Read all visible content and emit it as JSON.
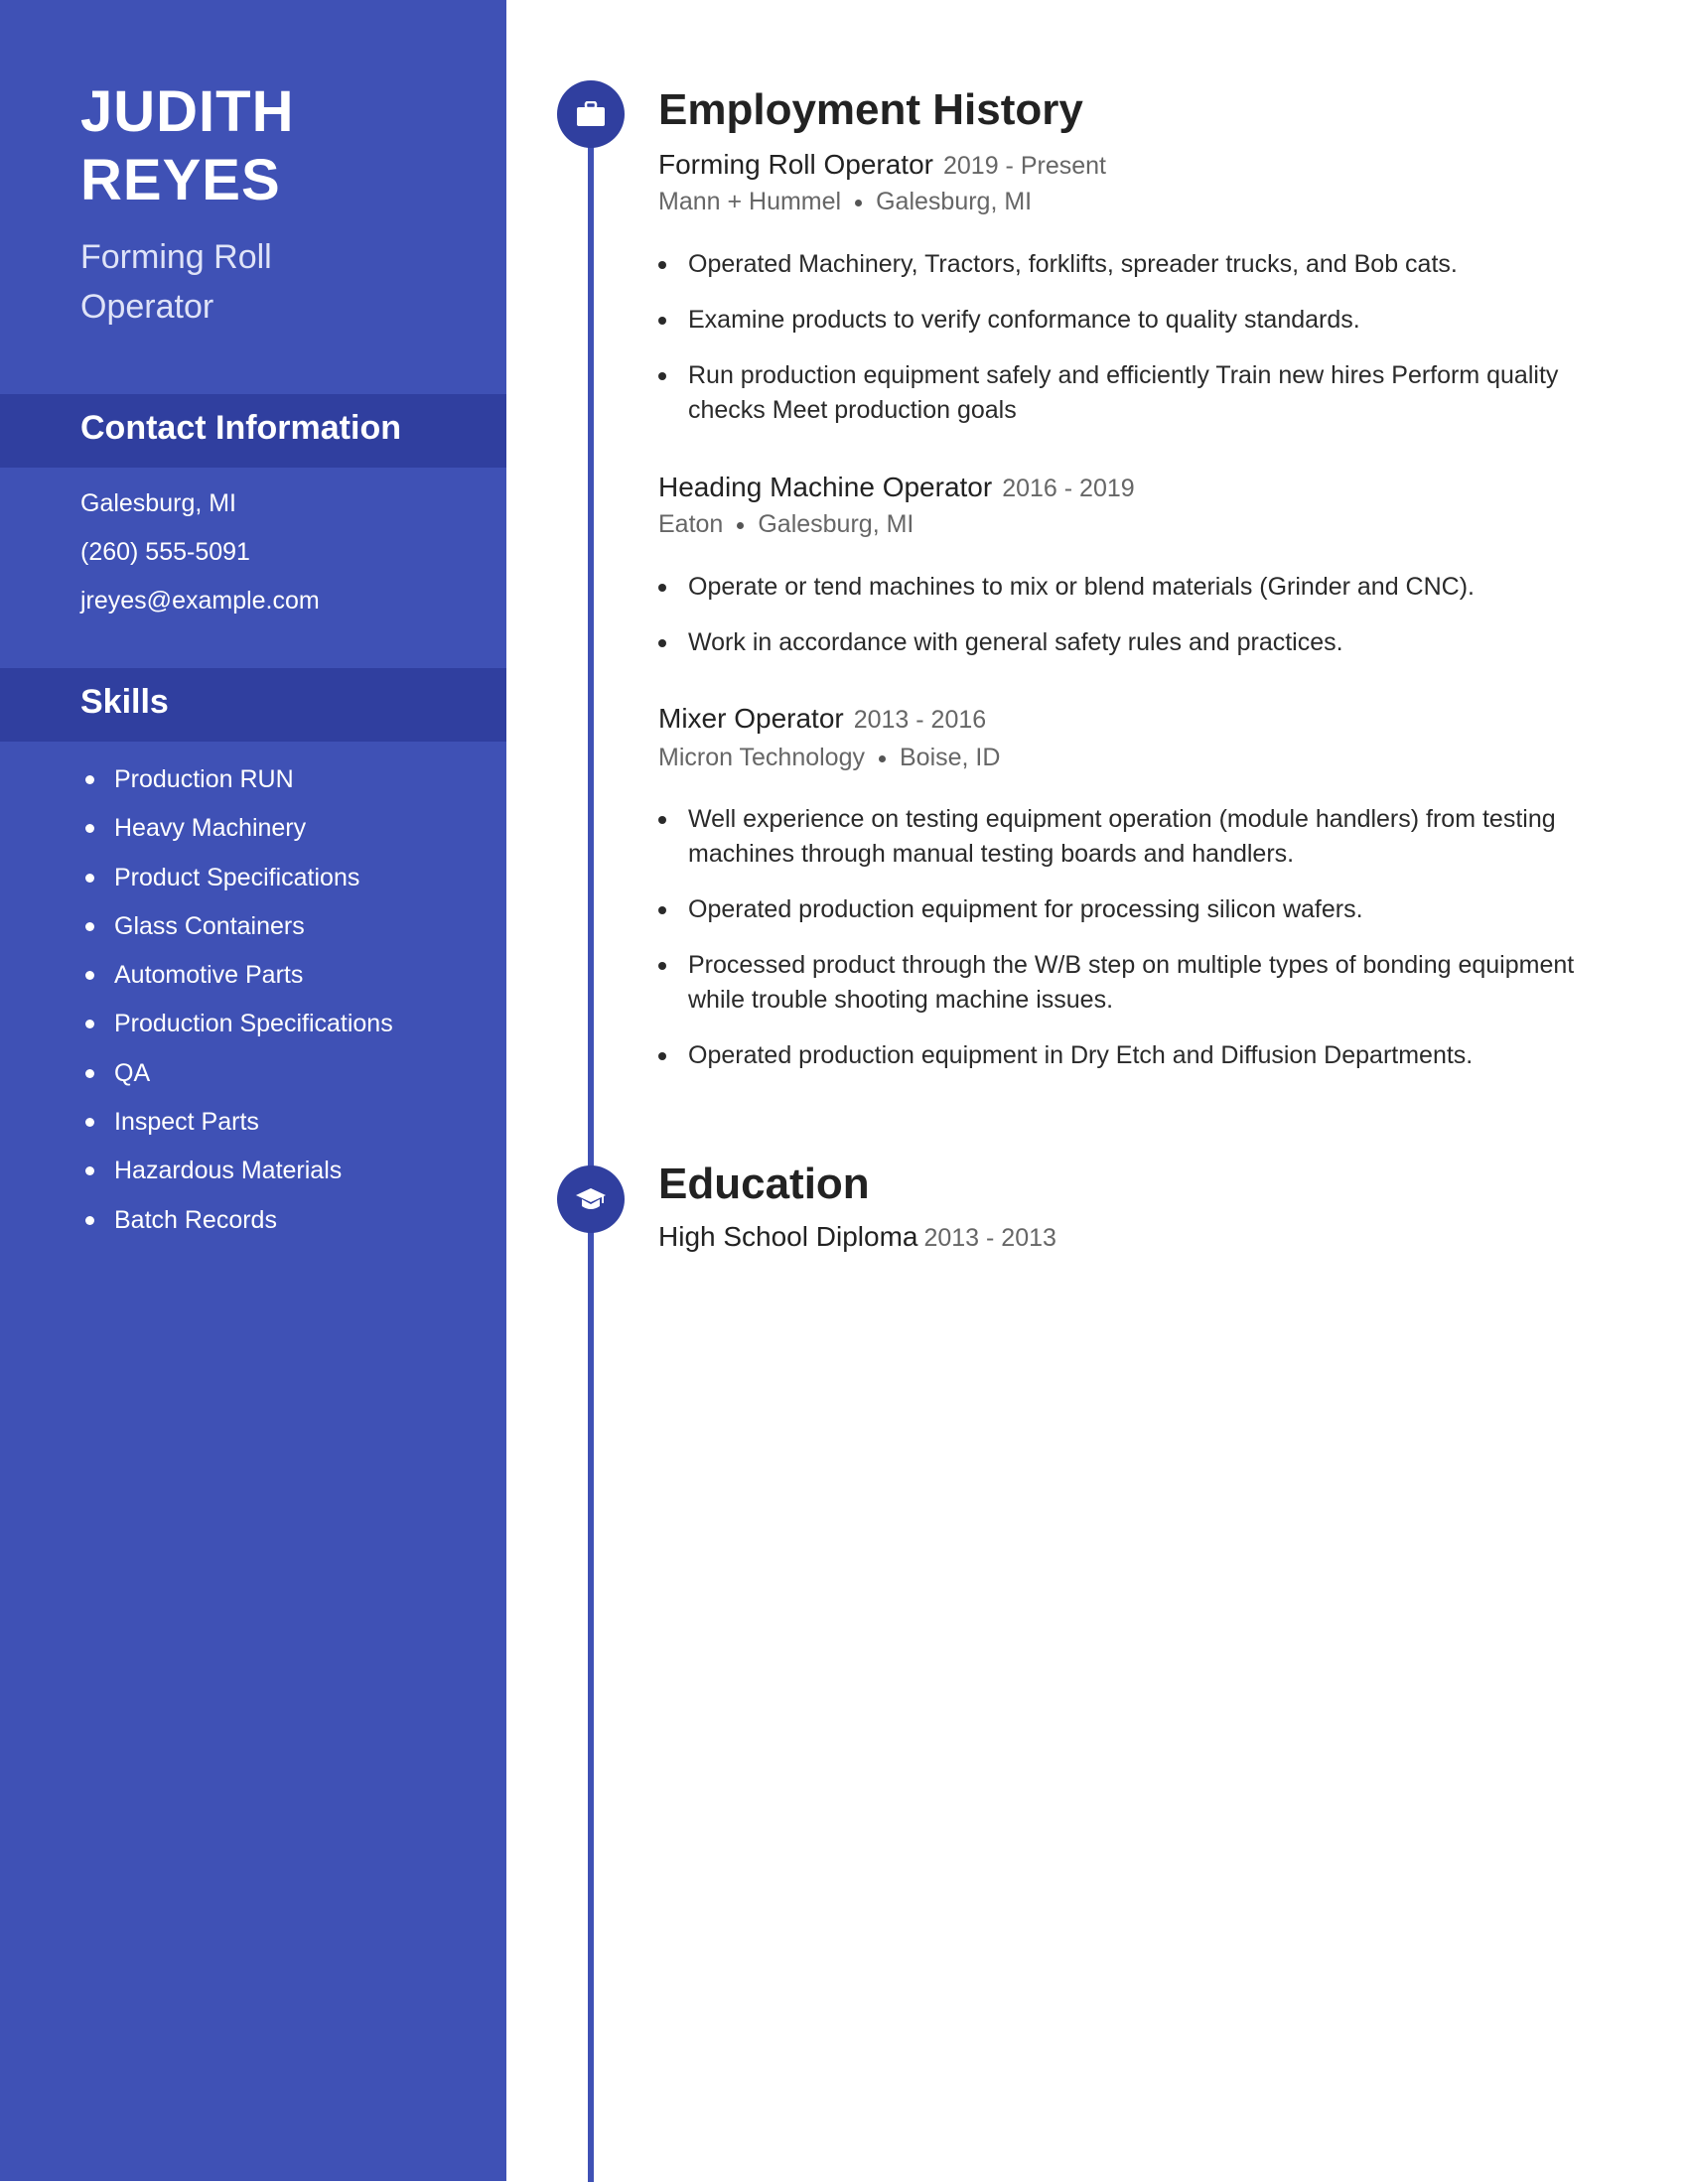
{
  "profile": {
    "first_name": "JUDITH",
    "last_name": "REYES",
    "title_line1": "Forming Roll",
    "title_line2": "Operator"
  },
  "contact": {
    "heading": "Contact Information",
    "items": [
      "Galesburg, MI",
      "(260) 555-5091",
      "jreyes@example.com"
    ]
  },
  "skills": {
    "heading": "Skills",
    "items": [
      "Production RUN",
      "Heavy Machinery",
      "Product Specifications",
      "Glass Containers",
      "Automotive Parts",
      "Production Specifications",
      "QA",
      "Inspect Parts",
      "Hazardous Materials",
      "Batch Records"
    ]
  },
  "employment": {
    "heading": "Employment History",
    "icon": "briefcase-icon",
    "jobs": [
      {
        "title": "Forming Roll Operator",
        "dates": "2019 - Present",
        "company": "Mann + Hummel",
        "location": "Galesburg, MI",
        "bullets": [
          "Operated Machinery, Tractors, forklifts, spreader trucks, and Bob cats.",
          "Examine products to verify conformance to quality standards.",
          "Run production equipment safely and efficiently Train new hires Perform quality checks Meet production goals"
        ]
      },
      {
        "title": "Heading Machine Operator",
        "dates": "2016 - 2019",
        "company": "Eaton",
        "location": "Galesburg, MI",
        "bullets": [
          "Operate or tend machines to mix or blend materials (Grinder and CNC).",
          "Work in accordance with general safety rules and practices."
        ]
      },
      {
        "title": "Mixer Operator",
        "dates": "2013 - 2016",
        "company": "Micron Technology",
        "location": "Boise, ID",
        "bullets": [
          "Well experience on testing equipment operation (module handlers) from testing machines through manual testing boards and handlers.",
          "Operated production equipment for processing silicon wafers.",
          "Processed product through the W/B step on multiple types of bonding equipment while trouble shooting machine issues.",
          "Operated production equipment in Dry Etch and Diffusion Departments."
        ]
      }
    ]
  },
  "education": {
    "heading": "Education",
    "icon": "graduation-cap-icon",
    "items": [
      {
        "degree": "High School Diploma",
        "dates": "2013 - 2013"
      }
    ]
  },
  "colors": {
    "sidebar": "#3f51b5",
    "band": "#303f9f",
    "timeline": "#3f51b5"
  }
}
